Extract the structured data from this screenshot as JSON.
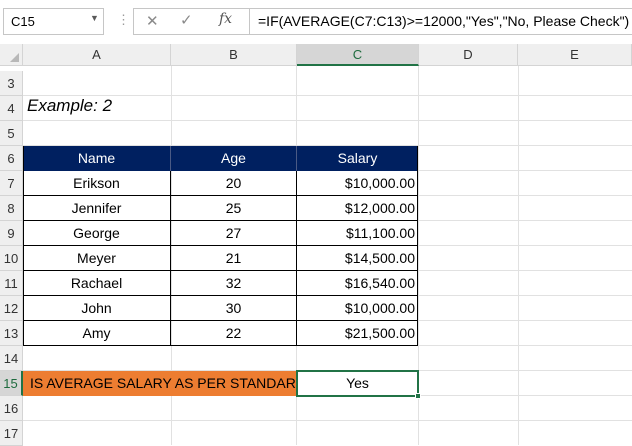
{
  "formula_bar": {
    "name_box": "C15",
    "cancel_icon": "✕",
    "enter_icon": "✓",
    "fx_label": "fx",
    "formula": "=IF(AVERAGE(C7:C13)>=12000,\"Yes\",\"No, Please Check\")"
  },
  "columns": [
    "A",
    "B",
    "C",
    "D",
    "E"
  ],
  "selected_column": "C",
  "rows": [
    "3",
    "4",
    "5",
    "6",
    "7",
    "8",
    "9",
    "10",
    "11",
    "12",
    "13",
    "14",
    "15",
    "16",
    "17"
  ],
  "selected_row": "15",
  "example_title": "Example: 2",
  "table": {
    "headers": [
      "Name",
      "Age",
      "Salary"
    ],
    "rows": [
      [
        "Erikson",
        "20",
        "$10,000.00"
      ],
      [
        "Jennifer",
        "25",
        "$12,000.00"
      ],
      [
        "George",
        "27",
        "$11,100.00"
      ],
      [
        "Meyer",
        "21",
        "$14,500.00"
      ],
      [
        "Rachael",
        "32",
        "$16,540.00"
      ],
      [
        "John",
        "30",
        "$10,000.00"
      ],
      [
        "Amy",
        "22",
        "$21,500.00"
      ]
    ]
  },
  "question": "IS AVERAGE SALARY AS PER STANDARD?",
  "answer": "Yes",
  "colors": {
    "header_fill": "#002060",
    "question_fill": "#ED7D31",
    "selection": "#217346"
  }
}
